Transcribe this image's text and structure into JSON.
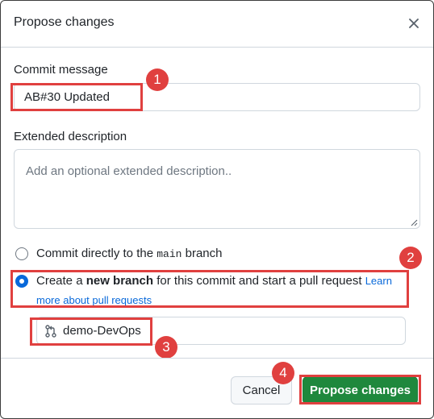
{
  "dialog": {
    "title": "Propose changes",
    "close_icon": "close-icon"
  },
  "commit_message": {
    "label": "Commit message",
    "value": "AB#30 Updated"
  },
  "extended_description": {
    "label": "Extended description",
    "placeholder": "Add an optional extended description.."
  },
  "options": {
    "direct": {
      "prefix": "Commit directly to the ",
      "branch": "main",
      "suffix": " branch",
      "selected": false
    },
    "new_branch": {
      "prefix": "Create a ",
      "bold": "new branch",
      "suffix": " for this commit and start a pull request ",
      "link_part1": "Learn",
      "link_part2": "more about pull requests",
      "selected": true
    }
  },
  "branch": {
    "icon": "git-pull-request-icon",
    "name": "demo-DevOps"
  },
  "buttons": {
    "cancel": "Cancel",
    "propose": "Propose changes"
  },
  "annotations": [
    "1",
    "2",
    "3",
    "4"
  ],
  "colors": {
    "primary": "#1f883d",
    "link": "#0969da",
    "annotation": "#e0403f"
  }
}
